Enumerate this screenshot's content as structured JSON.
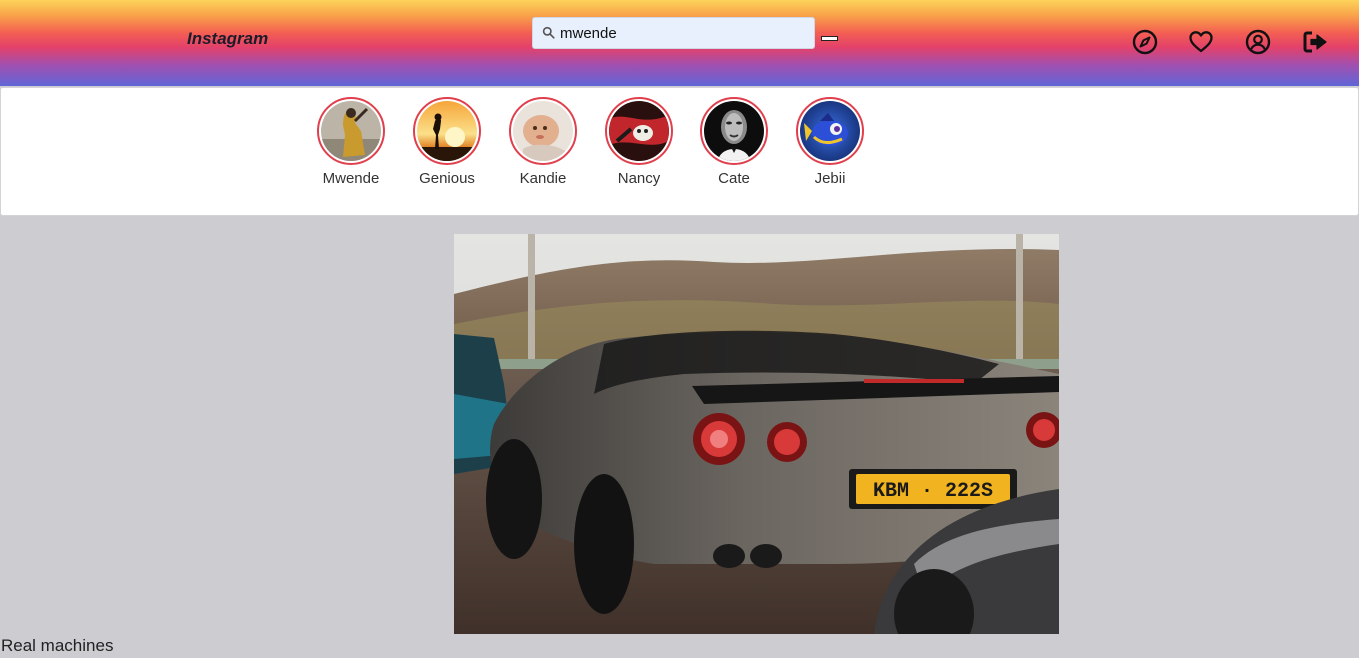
{
  "header": {
    "brand": "Instagram",
    "search": {
      "value": "mwende",
      "icon": "search-icon"
    },
    "nav_icons": [
      "compass-icon",
      "heart-icon",
      "user-circle-icon",
      "sign-out-icon"
    ]
  },
  "stories": [
    {
      "label": "Mwende"
    },
    {
      "label": "Genious"
    },
    {
      "label": "Kandie"
    },
    {
      "label": "Nancy"
    },
    {
      "label": "Cate"
    },
    {
      "label": "Jebii"
    }
  ],
  "post": {
    "plate": "KBM · 222S",
    "caption": "Real machines"
  },
  "colors": {
    "story_ring": "#e0404d",
    "page_background": "#cdcdd1"
  }
}
